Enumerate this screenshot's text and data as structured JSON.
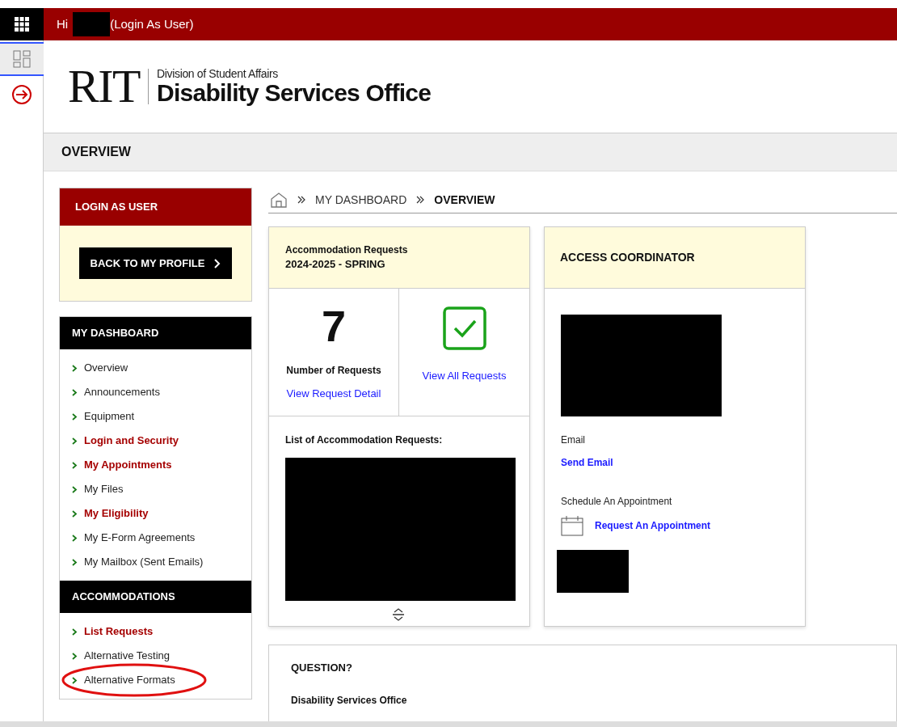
{
  "top_bar": {
    "greeting": "Hi",
    "suffix": "(Login As User)"
  },
  "logo": {
    "wordmark": "RIT",
    "division": "Division of Student Affairs",
    "office": "Disability Services Office"
  },
  "page_title": "OVERVIEW",
  "login_panel": {
    "title": "LOGIN AS USER",
    "button": "BACK TO MY PROFILE"
  },
  "sections": [
    {
      "title": "MY DASHBOARD",
      "items": [
        {
          "label": "Overview",
          "emphasized": false,
          "circled": false
        },
        {
          "label": "Announcements",
          "emphasized": false,
          "circled": false
        },
        {
          "label": "Equipment",
          "emphasized": false,
          "circled": false
        },
        {
          "label": "Login and Security",
          "emphasized": true,
          "circled": false
        },
        {
          "label": "My Appointments",
          "emphasized": true,
          "circled": false
        },
        {
          "label": "My Files",
          "emphasized": false,
          "circled": false
        },
        {
          "label": "My Eligibility",
          "emphasized": true,
          "circled": false
        },
        {
          "label": "My E-Form Agreements",
          "emphasized": false,
          "circled": false
        },
        {
          "label": "My Mailbox (Sent Emails)",
          "emphasized": false,
          "circled": false
        }
      ]
    },
    {
      "title": "ACCOMMODATIONS",
      "items": [
        {
          "label": "List Requests",
          "emphasized": true,
          "circled": false
        },
        {
          "label": "Alternative Testing",
          "emphasized": false,
          "circled": false
        },
        {
          "label": "Alternative Formats",
          "emphasized": false,
          "circled": true
        }
      ]
    }
  ],
  "breadcrumb": [
    "MY DASHBOARD",
    "OVERVIEW"
  ],
  "requests_card": {
    "title": "Accommodation Requests",
    "term": "2024-2025 - SPRING",
    "count": "7",
    "count_label": "Number of Requests",
    "detail_link": "View Request Detail",
    "all_link": "View All Requests",
    "list_label": "List of Accommodation Requests:"
  },
  "coordinator_card": {
    "title": "ACCESS COORDINATOR",
    "email_label": "Email",
    "email_link": "Send Email",
    "schedule_label": "Schedule An Appointment",
    "schedule_link": "Request An Appointment"
  },
  "question_card": {
    "title": "QUESTION?",
    "office": "Disability Services Office"
  }
}
